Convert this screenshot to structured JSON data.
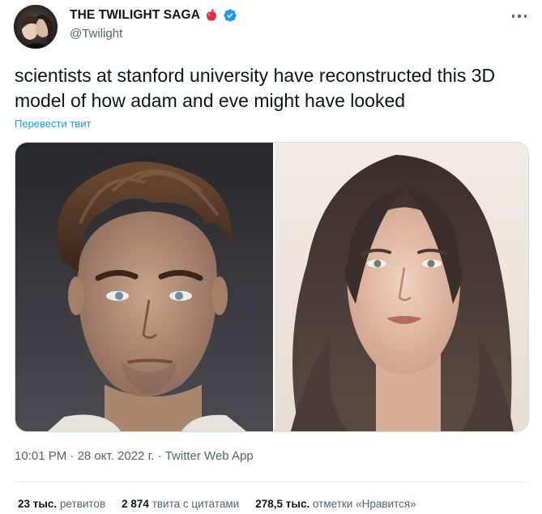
{
  "author": {
    "display_name": "THE TWILIGHT SAGA",
    "handle": "@Twilight",
    "emoji_icon": "red-apple-icon",
    "verified_icon": "verified-badge-icon",
    "verified_color": "#1d9bf0"
  },
  "tweet": {
    "text": "scientists at stanford university have reconstructed this 3D model of how adam and eve might have looked",
    "translate_label": "Перевести твит"
  },
  "meta": {
    "time": "10:01 PM",
    "sep1": " · ",
    "date": "28 окт. 2022 г.",
    "sep2": " · ",
    "app": "Twitter Web App"
  },
  "stats": {
    "retweets_value": "23 тыс.",
    "retweets_label": "ретвитов",
    "quotes_value": "2 874",
    "quotes_label": "твита с цитатами",
    "likes_value": "278,5 тыс.",
    "likes_label": "отметки «Нравится»"
  },
  "colors": {
    "link": "#1d9bf0",
    "secondary_text": "#536471",
    "primary_text": "#0f1419"
  }
}
